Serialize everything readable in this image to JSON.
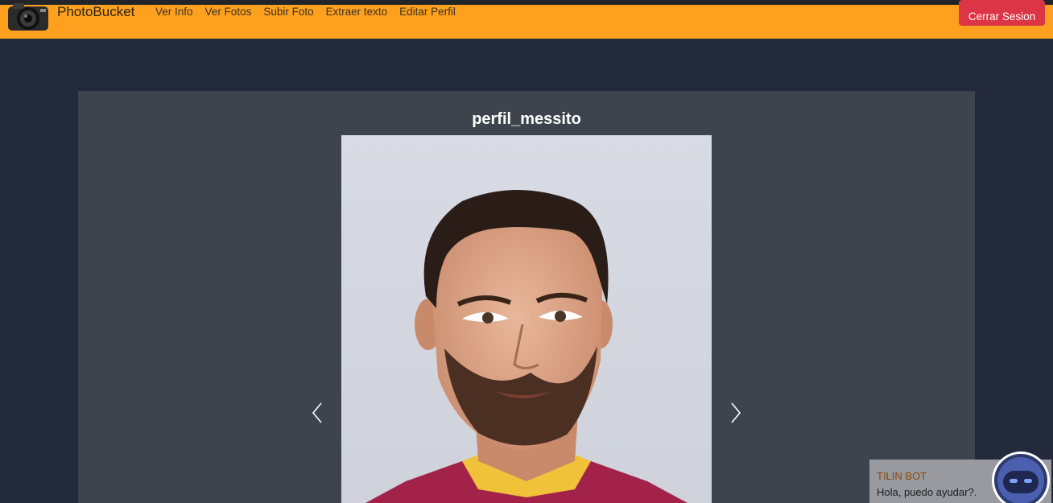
{
  "app": {
    "brand": "PhotoBucket",
    "icons": {
      "logo": "camera-icon",
      "prev": "chevron-left-icon",
      "next": "chevron-right-icon",
      "bot": "robot-icon"
    }
  },
  "navbar": {
    "links": [
      "Ver Info",
      "Ver Fotos",
      "Subir Foto",
      "Extraer texto",
      "Editar Perfil"
    ],
    "logout_label": "Cerrar Sesion"
  },
  "gallery": {
    "photo_title": "perfil_messito"
  },
  "chatbot": {
    "name": "TILIN BOT",
    "message": "Hola, puedo ayudar?."
  },
  "colors": {
    "navbar": "#ffa01f",
    "background": "#232a3b",
    "card": "#3d444d",
    "logout": "#dc3545"
  }
}
